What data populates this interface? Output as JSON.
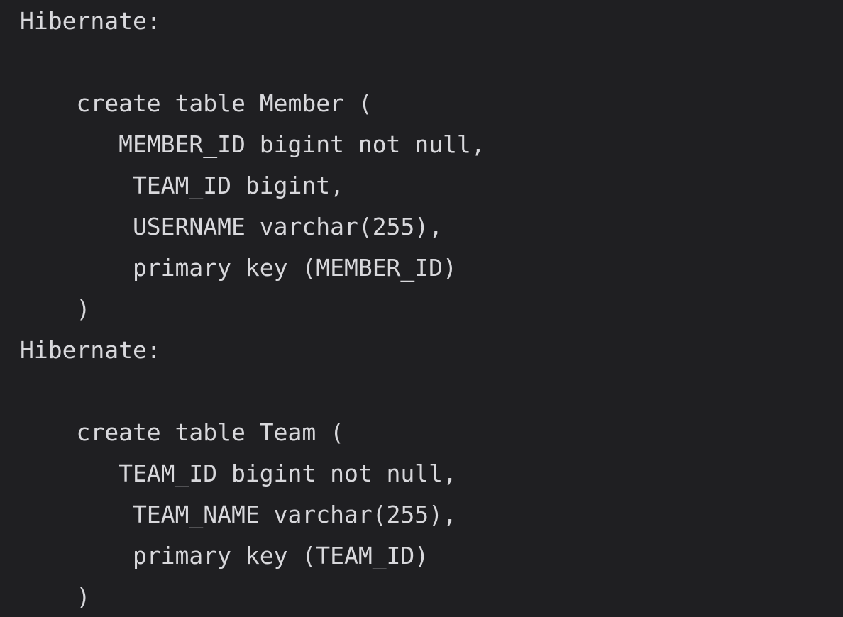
{
  "console": {
    "lines": [
      "Hibernate:",
      "",
      "    create table Member (",
      "       MEMBER_ID bigint not null,",
      "        TEAM_ID bigint,",
      "        USERNAME varchar(255),",
      "        primary key (MEMBER_ID)",
      "    )",
      "Hibernate:",
      "",
      "    create table Team (",
      "       TEAM_ID bigint not null,",
      "        TEAM_NAME varchar(255),",
      "        primary key (TEAM_ID)",
      "    )"
    ]
  },
  "colors": {
    "background": "#1f1f22",
    "text": "#d8d8dc"
  }
}
